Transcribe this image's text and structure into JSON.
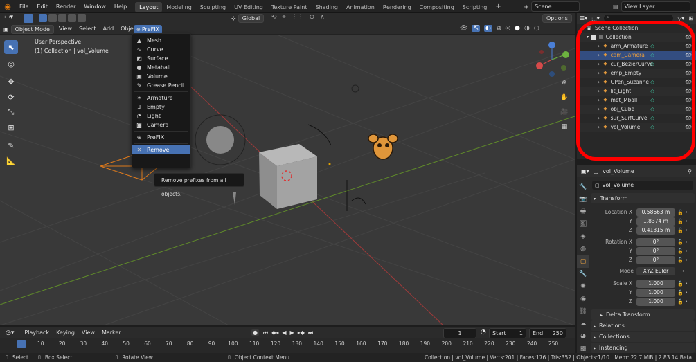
{
  "top_menu": [
    "File",
    "Edit",
    "Render",
    "Window",
    "Help"
  ],
  "workspaces": [
    "Layout",
    "Modeling",
    "Sculpting",
    "UV Editing",
    "Texture Paint",
    "Shading",
    "Animation",
    "Rendering",
    "Compositing",
    "Scripting"
  ],
  "scene": "Scene",
  "view_layer": "View Layer",
  "header": {
    "orientation": "Global",
    "options": "Options",
    "mode": "Object Mode",
    "menus": [
      "View",
      "Select",
      "Add",
      "Object"
    ],
    "prefix_menu": "PreFIX"
  },
  "viewport": {
    "line1": "User Perspective",
    "line2": "(1) Collection | vol_Volume"
  },
  "prefix_menu_items": [
    {
      "icon": "mesh-icon",
      "label": "Mesh",
      "glyph": "▲"
    },
    {
      "icon": "curve-icon",
      "label": "Curve",
      "glyph": "∿"
    },
    {
      "icon": "surface-icon",
      "label": "Surface",
      "glyph": "◩"
    },
    {
      "icon": "metaball-icon",
      "label": "Metaball",
      "glyph": "●"
    },
    {
      "icon": "volume-icon",
      "label": "Volume",
      "glyph": "▣"
    },
    {
      "icon": "grease-pencil-icon",
      "label": "Grease Pencil",
      "glyph": "✎"
    },
    {
      "icon": "armature-icon",
      "label": "Armature",
      "glyph": "✶"
    },
    {
      "icon": "empty-icon",
      "label": "Empty",
      "glyph": "⅃"
    },
    {
      "icon": "light-icon",
      "label": "Light",
      "glyph": "◔"
    },
    {
      "icon": "camera-icon",
      "label": "Camera",
      "glyph": "◙"
    },
    {
      "icon": "prefix-icon",
      "label": "PreFIX",
      "glyph": "⊕"
    },
    {
      "icon": "remove-icon",
      "label": "Remove",
      "glyph": "✕"
    }
  ],
  "tooltip": "Remove prefixes from all objects.",
  "timeline": {
    "menus": [
      "Playback",
      "Keying",
      "View",
      "Marker"
    ],
    "current_frame": "1",
    "start_label": "Start",
    "start": "1",
    "end_label": "End",
    "end": "250",
    "ticks": [
      "1",
      "10",
      "20",
      "30",
      "40",
      "50",
      "60",
      "70",
      "80",
      "90",
      "100",
      "110",
      "120",
      "130",
      "140",
      "150",
      "160",
      "170",
      "180",
      "190",
      "200",
      "210",
      "220",
      "230",
      "240",
      "250"
    ]
  },
  "status": {
    "select": "Select",
    "box_select": "Box Select",
    "rotate_view": "Rotate View",
    "context_menu": "Object Context Menu",
    "stats": "Collection | vol_Volume | Verts:201 | Faces:176 | Tris:352 | Objects:1/10 | Mem: 22.7 MiB | 2.83.14 Beta"
  },
  "outliner": {
    "root": "Scene Collection",
    "collection": "Collection",
    "items": [
      {
        "name": "arm_Armature",
        "icon": "armature-icon",
        "color": "#e59a3c",
        "sub": "pose-icon",
        "subcolor": "#3fc19e"
      },
      {
        "name": "cam_Camera",
        "icon": "camera-icon",
        "color": "#e59a3c",
        "sub": "camera-data-icon",
        "subcolor": "#3fc19e"
      },
      {
        "name": "cur_BezierCurve",
        "icon": "curve-icon",
        "color": "#e59a3c",
        "sub": "curve-data-icon",
        "subcolor": "#3fc19e"
      },
      {
        "name": "emp_Empty",
        "icon": "empty-icon",
        "color": "#e59a3c",
        "sub": "",
        "subcolor": ""
      },
      {
        "name": "GPen_Suzanne",
        "icon": "grease-pencil-icon",
        "color": "#e59a3c",
        "sub": "gp-data-icon",
        "subcolor": "#3fc19e"
      },
      {
        "name": "lit_Light",
        "icon": "light-icon",
        "color": "#e59a3c",
        "sub": "light-data-icon",
        "subcolor": "#3fc19e"
      },
      {
        "name": "met_Mball",
        "icon": "metaball-icon",
        "color": "#e59a3c",
        "sub": "mball-data-icon",
        "subcolor": "#3fc19e"
      },
      {
        "name": "obj_Cube",
        "icon": "mesh-icon",
        "color": "#e59a3c",
        "sub": "mesh-data-icon",
        "subcolor": "#3fc19e"
      },
      {
        "name": "sur_SurfCurve",
        "icon": "surface-icon",
        "color": "#e59a3c",
        "sub": "surface-data-icon",
        "subcolor": "#3fc19e"
      },
      {
        "name": "vol_Volume",
        "icon": "volume-icon",
        "color": "#e59a3c",
        "sub": "volume-data-icon",
        "subcolor": "#3fc19e"
      }
    ]
  },
  "properties": {
    "object_name": "vol_Volume",
    "object_field": "vol_Volume",
    "section_transform": "Transform",
    "location": {
      "label": "Location X",
      "x": "0.58663 m",
      "y": "1.8374 m",
      "z": "0.41315 m"
    },
    "rotation": {
      "label": "Rotation X",
      "x": "0°",
      "y": "0°",
      "z": "0°"
    },
    "mode": {
      "label": "Mode",
      "value": "XYZ Euler"
    },
    "scale": {
      "label": "Scale X",
      "x": "1.000",
      "y": "1.000",
      "z": "1.000"
    },
    "axis_y": "Y",
    "axis_z": "Z",
    "subsections": [
      "Delta Transform",
      "Relations",
      "Collections",
      "Instancing"
    ]
  },
  "colors": {
    "accent": "#4772b3",
    "selected_text": "#f0a13c",
    "annotation": "#ff0000",
    "grid_red": "#a03a3a",
    "grid_green": "#5f8a2a"
  }
}
